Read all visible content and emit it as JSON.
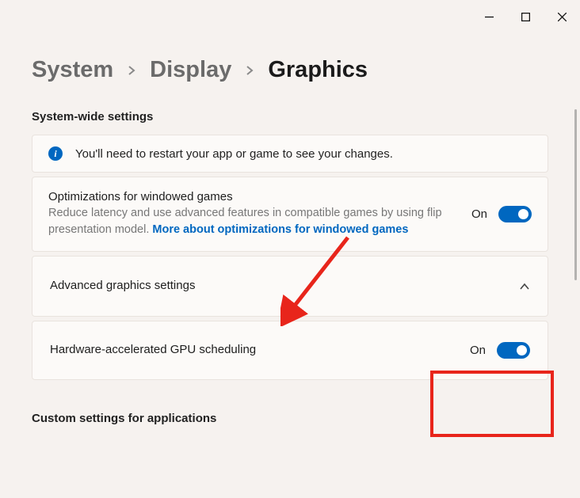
{
  "breadcrumb": {
    "item1": "System",
    "item2": "Display",
    "item3": "Graphics"
  },
  "sections": {
    "systemwide_heading": "System-wide settings",
    "customapps_heading": "Custom settings for applications"
  },
  "info_banner": {
    "text": "You'll need to restart your app or game to see your changes."
  },
  "windowed_opt": {
    "title": "Optimizations for windowed games",
    "desc_prefix": "Reduce latency and use advanced features in compatible games by using flip presentation model.  ",
    "link_text": "More about optimizations for windowed games",
    "state_label": "On"
  },
  "advanced_expander": {
    "title": "Advanced graphics settings"
  },
  "gpu_sched": {
    "title": "Hardware-accelerated GPU scheduling",
    "state_label": "On"
  },
  "colors": {
    "accent": "#0067c0",
    "annotation": "#e8251b"
  }
}
